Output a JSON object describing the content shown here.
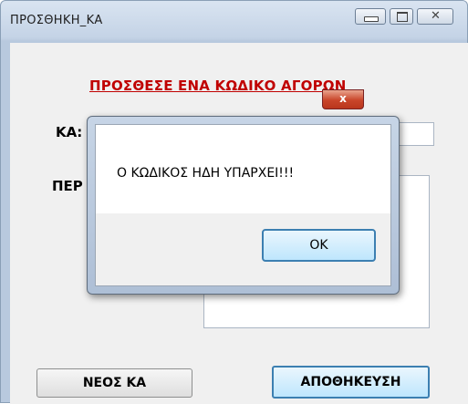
{
  "window": {
    "title": "ΠΡΟΣΘΗΚΗ_ΚΑ",
    "close_glyph": "✕"
  },
  "form": {
    "heading": "ΠΡΟΣΘΕΣΕ ΕΝΑ ΚΩΔΙΚΟ ΑΓΟΡΩΝ",
    "label_code": "ΚΑ:",
    "label_description": "ΠΕΡ",
    "code_value": "",
    "description_value": "",
    "new_button": "ΝΕΟΣ ΚΑ",
    "save_button": "ΑΠΟΘΗΚΕΥΣΗ"
  },
  "dialog": {
    "message": "Ο ΚΩΔΙΚΟΣ ΗΔΗ ΥΠΑΡΧΕΙ!!!",
    "ok_button": "OK",
    "close_glyph": "x"
  },
  "colors": {
    "heading": "#c00000",
    "default_button_border": "#3c7fb1"
  }
}
